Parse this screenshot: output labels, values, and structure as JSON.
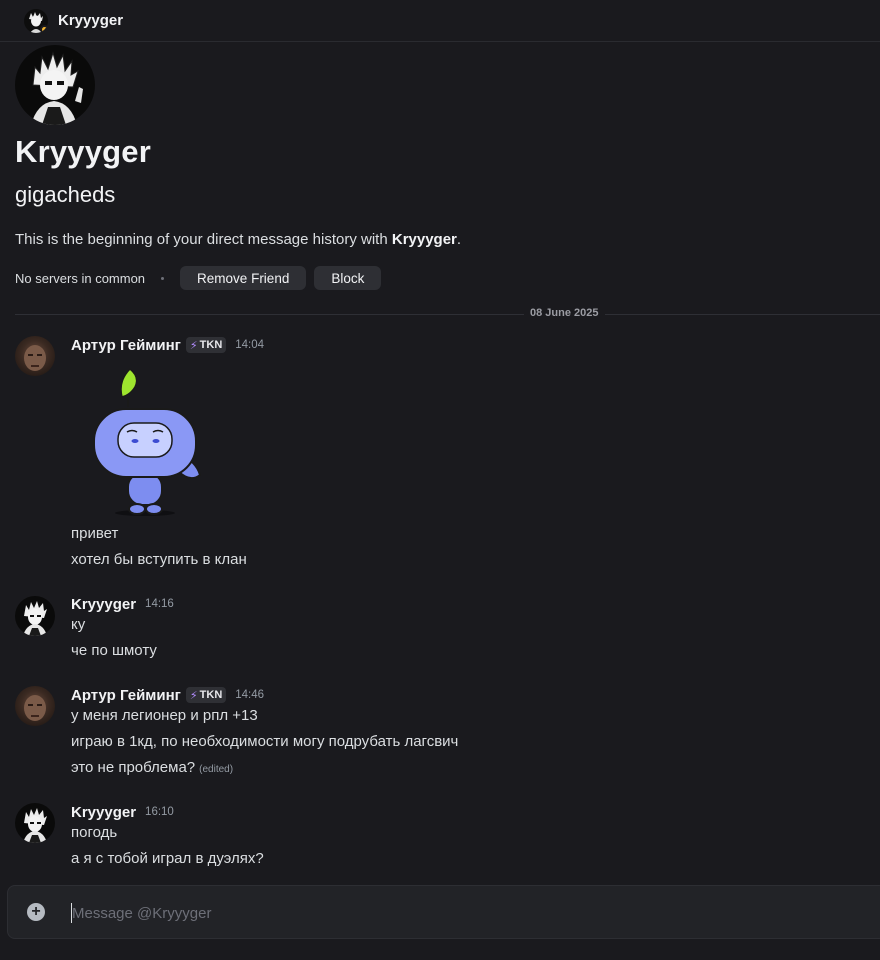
{
  "header": {
    "name": "Kryyyger"
  },
  "profile": {
    "display_name": "Kryyyger",
    "username": "gigacheds",
    "intro_prefix": "This is the beginning of your direct message history with ",
    "intro_name": "Kryyyger",
    "intro_suffix": ".",
    "no_servers": "No servers in common",
    "remove_friend": "Remove Friend",
    "block": "Block"
  },
  "date_divider": "08 June 2025",
  "messages": [
    {
      "author": "Артур Гейминг",
      "tag": "TKN",
      "time": "14:04",
      "lines": [
        "привет",
        "хотел бы вступить в клан"
      ]
    },
    {
      "author": "Kryyyger",
      "time": "14:16",
      "lines": [
        "ку",
        "че по шмоту"
      ]
    },
    {
      "author": "Артур Гейминг",
      "tag": "TKN",
      "time": "14:46",
      "lines": [
        "у меня легионер и рпл +13",
        "играю в 1кд, по необходимости могу подрубать лагсвич",
        "это не проблема?"
      ],
      "edited": "(edited)"
    },
    {
      "author": "Kryyyger",
      "time": "16:10",
      "lines": [
        "погодь",
        "а я с тобой играл в дуэлях?"
      ]
    }
  ],
  "composer": {
    "placeholder": "Message @Kryyyger"
  },
  "colors": {
    "background": "#1a1a1e",
    "idle_status": "#f0b232",
    "tag_bolt": "#b28cff",
    "sticker_body": "#7d8df0",
    "leaf": "#9ee52e"
  },
  "icons": [
    "anime-avatar-icon",
    "status-idle-icon",
    "lightning-icon",
    "wumpus-sticker",
    "plus-circle-icon"
  ]
}
